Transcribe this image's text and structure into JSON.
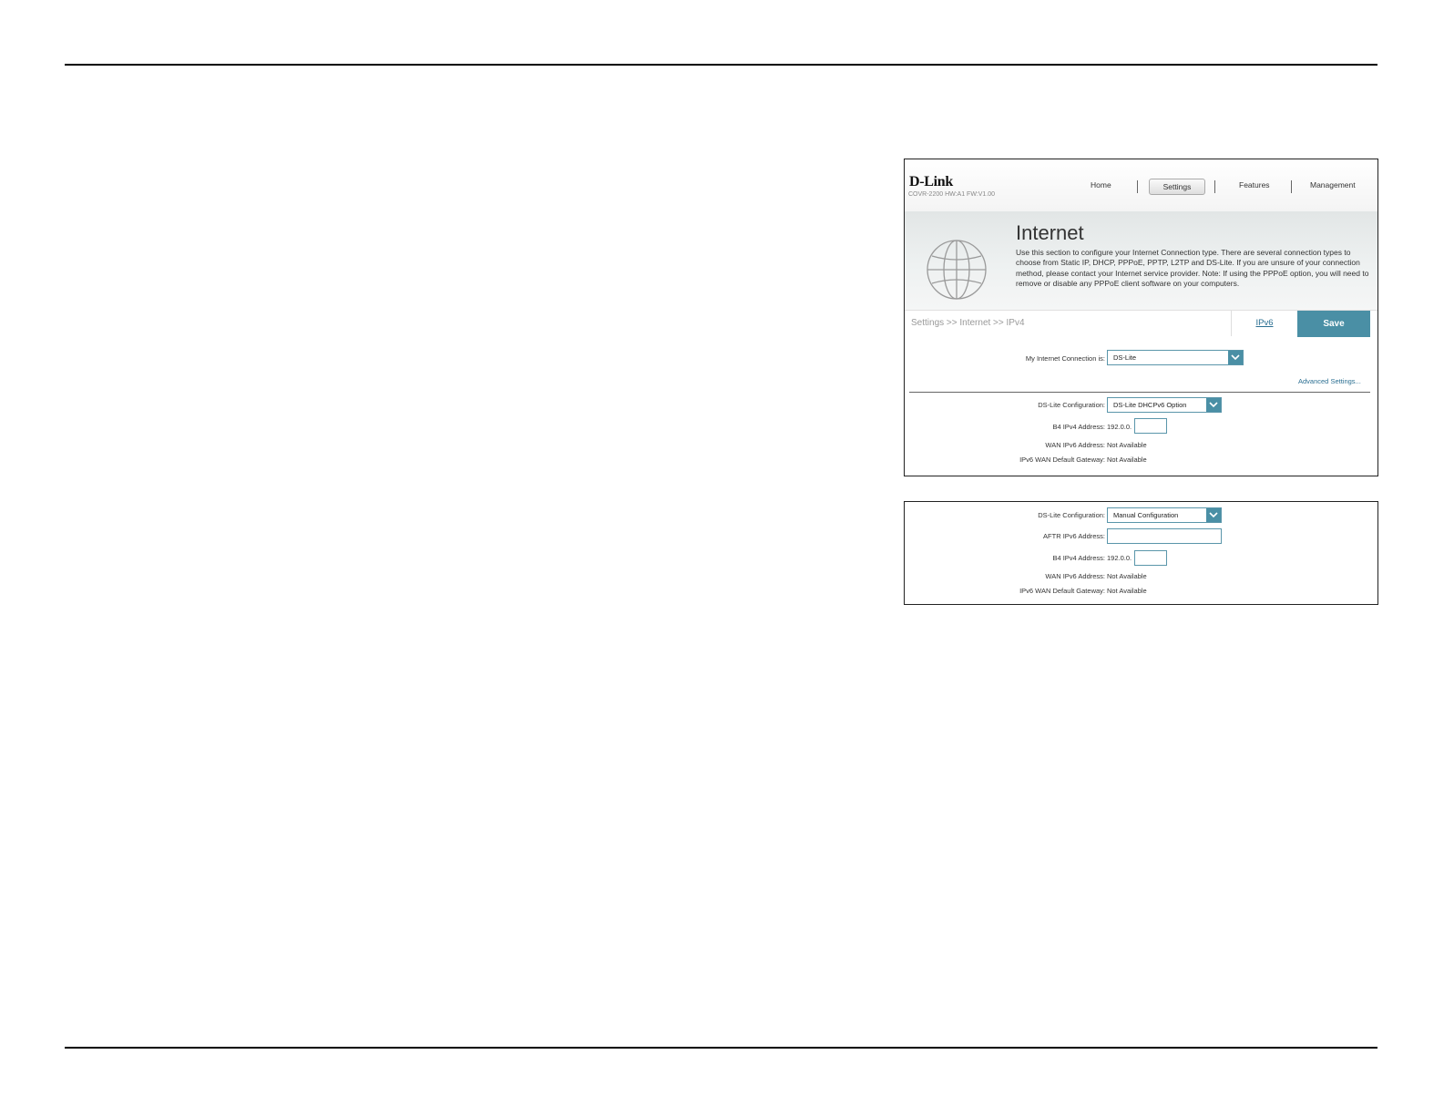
{
  "header": {
    "logo": "D-Link",
    "model": "COVR-2200 HW:A1 FW:V1.00",
    "nav": [
      "Home",
      "Settings",
      "Features",
      "Management"
    ]
  },
  "hero": {
    "title": "Internet",
    "description": "Use this section to configure your Internet Connection type. There are several connection types to choose from Static IP, DHCP, PPPoE, PPTP, L2TP and DS-Lite. If you are unsure of your connection method, please contact your Internet service provider. Note: If using the PPPoE option, you will need to remove or disable any PPPoE client software on your computers."
  },
  "toolbar": {
    "breadcrumb": "Settings >> Internet >> IPv4",
    "ipv6_link": "IPv6",
    "save_label": "Save"
  },
  "connection": {
    "label": "My Internet Connection is:",
    "value": "DS-Lite",
    "advanced_link": "Advanced Settings..."
  },
  "panel1": {
    "dslite_label": "DS-Lite Configuration:",
    "dslite_value": "DS-Lite DHCPv6 Option",
    "b4_label": "B4 IPv4 Address:",
    "b4_prefix": "192.0.0.",
    "wan_label": "WAN IPv6 Address:",
    "wan_value": "Not Available",
    "gw_label": "IPv6 WAN Default Gateway:",
    "gw_value": "Not Available"
  },
  "panel2": {
    "dslite_label": "DS-Lite Configuration:",
    "dslite_value": "Manual Configuration",
    "aftr_label": "AFTR IPv6 Address:",
    "b4_label": "B4 IPv4 Address:",
    "b4_prefix": "192.0.0.",
    "wan_label": "WAN IPv6 Address:",
    "wan_value": "Not Available",
    "gw_label": "IPv6 WAN Default Gateway:",
    "gw_value": "Not Available"
  },
  "colors": {
    "accent": "#4a8fa5",
    "link": "#2b6f92"
  }
}
